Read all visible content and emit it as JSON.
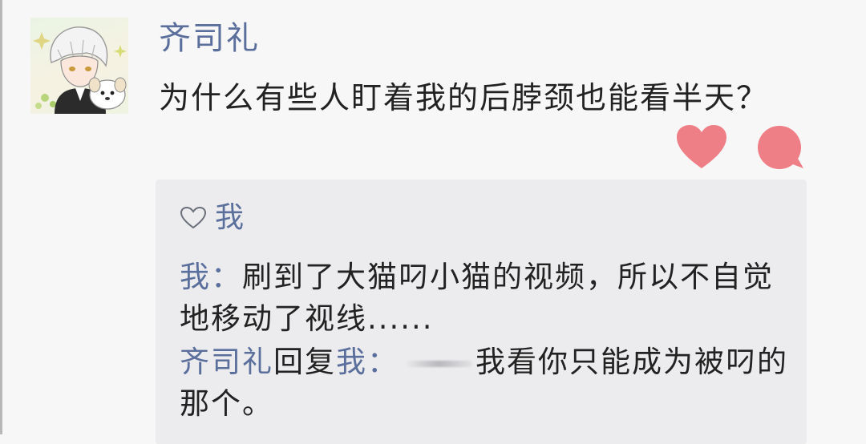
{
  "post": {
    "author": "齐司礼",
    "text": "为什么有些人盯着我的后脖颈也能看半天？"
  },
  "actions": {
    "like_icon": "heart-icon",
    "comment_icon": "comment-bubble-icon",
    "accent_color": "#ef7f86"
  },
  "replies": {
    "liked_by": "我",
    "comments": [
      {
        "name": "我",
        "sep": "：",
        "text": "刷到了大猫叼小猫的视频，所以不自觉地移动了视线......"
      },
      {
        "name": "齐司礼",
        "reply_word": "回复",
        "reply_to": "我",
        "sep": "：",
        "text": "我看你只能成为被叼的那个。"
      }
    ]
  },
  "colors": {
    "name": "#5a6f9c",
    "text": "#222222",
    "panel": "#ececee",
    "background": "#f7f7f7"
  }
}
